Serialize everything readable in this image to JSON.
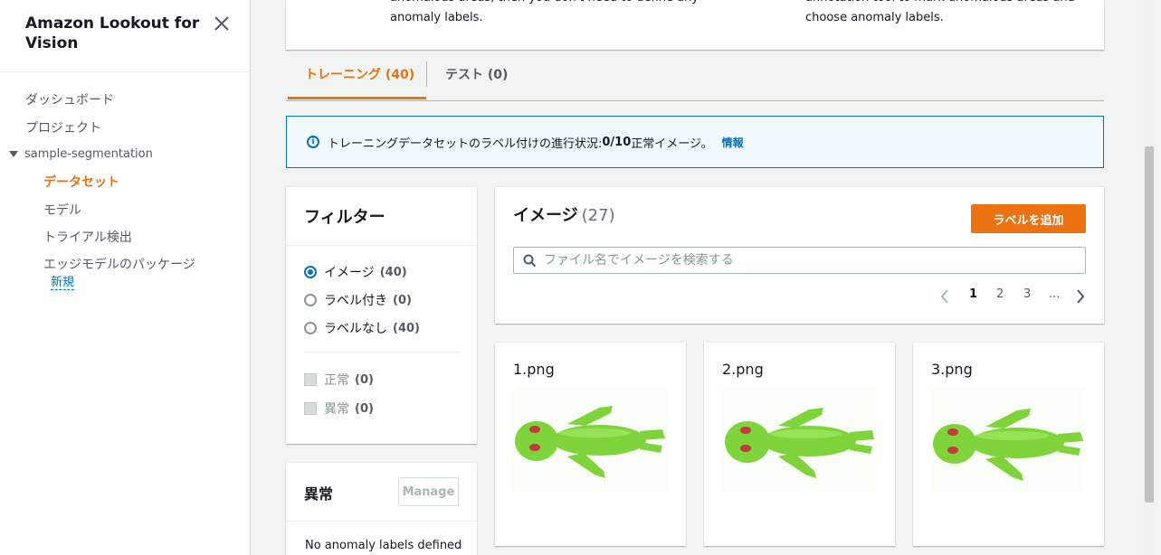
{
  "sidebar": {
    "title": "Amazon Lookout for Vision",
    "nav": {
      "dashboard": "ダッシュボード",
      "projects": "プロジェクト",
      "project_name": "sample-segmentation",
      "dataset": "データセット",
      "models": "モデル",
      "trial_detection": "トライアル検出",
      "edge_packages": "エッジモデルのパッケージ",
      "new_badge": "新規"
    }
  },
  "top_card": {
    "left_line1": "anomalous areas, then you don't need to define any",
    "left_line2": "anomaly labels.",
    "right_line1": "annotation tool to mark anomalous areas and",
    "right_line2": "choose anomaly labels."
  },
  "tabs": {
    "training": "トレーニング (40)",
    "test": "テスト (0)"
  },
  "alert": {
    "prefix": "トレーニングデータセットのラベル付けの進行状況: ",
    "progress": "0/10",
    "suffix": " 正常イメージ。",
    "link": "情報"
  },
  "filter": {
    "title": "フィルター",
    "options": [
      {
        "label": "イメージ",
        "count": "(40)",
        "selected": true
      },
      {
        "label": "ラベル付き",
        "count": "(0)",
        "selected": false
      },
      {
        "label": "ラベルなし",
        "count": "(40)",
        "selected": false
      }
    ],
    "checks": [
      {
        "label": "正常",
        "count": "(0)"
      },
      {
        "label": "異常",
        "count": "(0)"
      }
    ]
  },
  "anomaly_panel": {
    "title": "異常",
    "manage": "Manage",
    "empty": "No anomaly labels defined"
  },
  "images": {
    "title": "イメージ",
    "count": "(27)",
    "add_button": "ラベルを追加",
    "search_placeholder": "ファイル名でイメージを検索する",
    "pages": [
      "1",
      "2",
      "3",
      "..."
    ]
  },
  "cards": [
    {
      "name": "1.png"
    },
    {
      "name": "2.png"
    },
    {
      "name": "3.png"
    }
  ],
  "colors": {
    "accent": "#ec7211",
    "link": "#0073bb",
    "figure_green": "#7ed43a"
  }
}
